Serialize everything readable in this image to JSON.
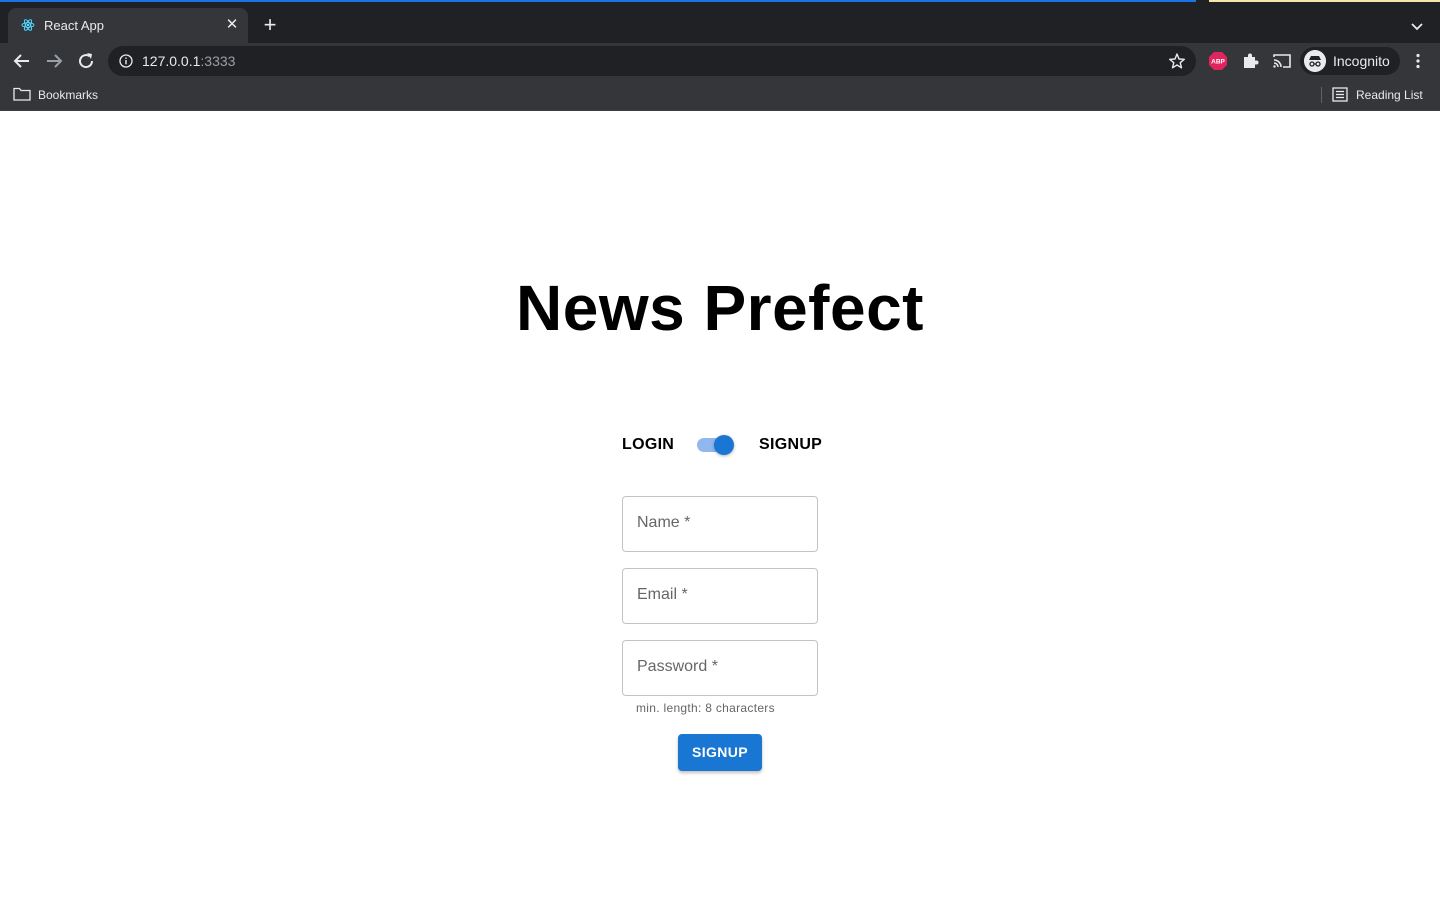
{
  "browser": {
    "tab_title": "React App",
    "url_host": "127.0.0.1",
    "url_port": ":3333",
    "profile_label": "Incognito",
    "bookmarks_label": "Bookmarks",
    "reading_list_label": "Reading List",
    "new_tab_symbol": "+",
    "close_symbol": "✕"
  },
  "page": {
    "heading": "News Prefect",
    "toggle": {
      "left_label": "LOGIN",
      "right_label": "SIGNUP",
      "checked": true
    },
    "fields": {
      "name_label": "Name *",
      "email_label": "Email *",
      "password_label": "Password *",
      "password_helper": "min. length: 8 characters"
    },
    "submit_label": "SIGNUP"
  },
  "colors": {
    "primary": "#1976d2",
    "chrome_dark": "#202124",
    "chrome_toolbar": "#35363a"
  }
}
